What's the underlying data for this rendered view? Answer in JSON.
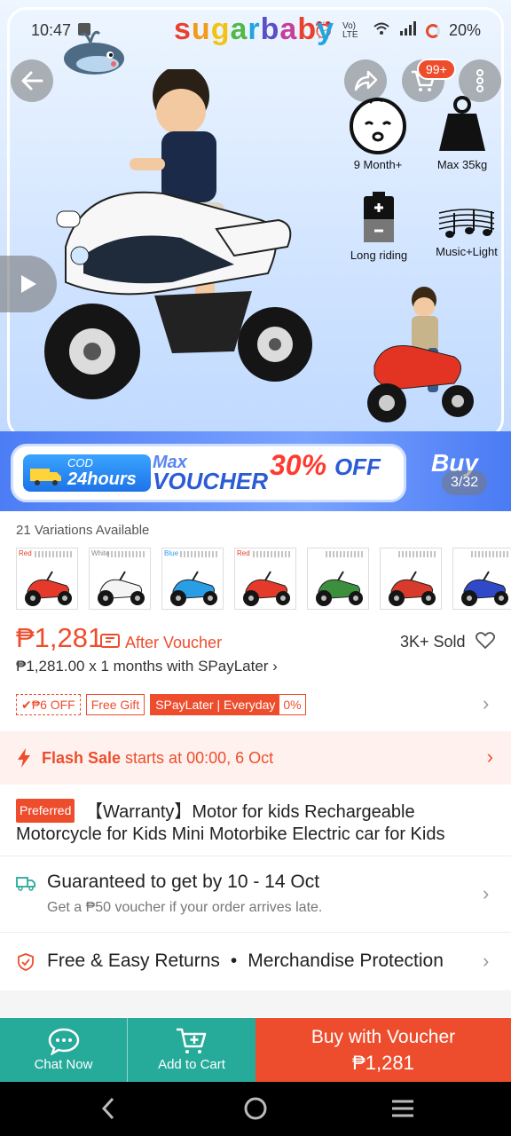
{
  "status_bar": {
    "time": "10:47",
    "battery": "20%",
    "net_label": "Vo) LTE"
  },
  "brand": {
    "letters": [
      "s",
      "u",
      "g",
      "a",
      "r",
      "b",
      "a",
      "b",
      "y"
    ]
  },
  "header": {
    "cart_badge": "99+"
  },
  "features": [
    {
      "label": "9 Month+",
      "icon": "baby-face-icon"
    },
    {
      "label": "Max 35kg",
      "icon": "weight-icon"
    },
    {
      "label": "Long riding",
      "icon": "battery-icon"
    },
    {
      "label": "Music+Light",
      "icon": "music-notes-icon"
    }
  ],
  "banner": {
    "cod_small": "COD",
    "cod_big": "24hours",
    "max_line": "Max",
    "voucher_line": "VOUCHER",
    "discount": "30%",
    "off": "OFF",
    "buy_side": "Buy",
    "image_counter": "3/32"
  },
  "variations": {
    "label": "21 Variations Available",
    "items": [
      {
        "tag": "Red",
        "color": "#e53a2a"
      },
      {
        "tag": "White",
        "color": "#f4f4f4"
      },
      {
        "tag": "Blue",
        "color": "#2a9ee5"
      },
      {
        "tag": "Red",
        "color": "#e53a2a"
      },
      {
        "tag": "",
        "color": "#3c8f3c"
      },
      {
        "tag": "",
        "color": "#d83a2c"
      },
      {
        "tag": "",
        "color": "#2f49c9"
      }
    ]
  },
  "pricing": {
    "price": "₱1,281",
    "after_voucher": "After Voucher",
    "sold": "3K+ Sold",
    "spaylater": "₱1,281.00 x 1 months with SPayLater ›"
  },
  "promos": {
    "off_chip": "✔₱6 OFF",
    "gift_chip": "Free Gift",
    "spay_chip": "SPayLater | Everyday",
    "spay_rate": "0%"
  },
  "flash_sale": {
    "label": "Flash Sale",
    "text": " starts at 00:00, 6 Oct"
  },
  "product": {
    "badge": "Preferred",
    "title": "【Warranty】Motor for kids Rechargeable Motorcycle for Kids Mini Motorbike Electric car for Kids"
  },
  "shipping": {
    "main": "Guaranteed to get by 10 - 14 Oct",
    "sub": "Get a ₱50 voucher if your order arrives late."
  },
  "returns": {
    "left": "Free & Easy Returns",
    "dot": "•",
    "right": "Merchandise Protection"
  },
  "bottom_bar": {
    "chat": "Chat Now",
    "cart": "Add to Cart",
    "buy_line1": "Buy with Voucher",
    "buy_line2": "₱1,281"
  },
  "colors": {
    "brand_orange": "#ee4d2d",
    "teal": "#26aa99"
  }
}
